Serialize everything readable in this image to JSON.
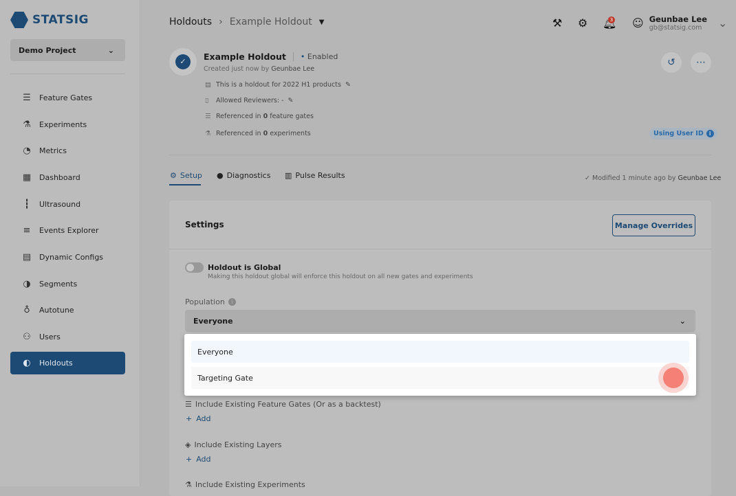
{
  "sidebar": {
    "brand": "STATSIG",
    "project": "Demo Project",
    "items": [
      {
        "label": "Feature Gates",
        "icon": "sliders-icon"
      },
      {
        "label": "Experiments",
        "icon": "flask-icon"
      },
      {
        "label": "Metrics",
        "icon": "gauge-icon"
      },
      {
        "label": "Dashboard",
        "icon": "dashboard-icon"
      },
      {
        "label": "Ultrasound",
        "icon": "waveform-icon"
      },
      {
        "label": "Events Explorer",
        "icon": "search-list-icon"
      },
      {
        "label": "Dynamic Configs",
        "icon": "config-icon"
      },
      {
        "label": "Segments",
        "icon": "pie-icon"
      },
      {
        "label": "Autotune",
        "icon": "autotune-icon"
      },
      {
        "label": "Users",
        "icon": "users-icon"
      },
      {
        "label": "Holdouts",
        "icon": "holdout-icon",
        "active": true
      }
    ]
  },
  "header": {
    "breadcrumb": [
      "Holdouts",
      "Example Holdout"
    ],
    "notifications": "3",
    "user_name": "Geunbae Lee",
    "user_email": "gb@statsig.com"
  },
  "holdout": {
    "name": "Example Holdout",
    "status": "Enabled",
    "created": "Created just now by",
    "creator": "Geunbae Lee",
    "description": "This is a holdout for 2022 H1 products",
    "reviewers": "Allowed Reviewers: -",
    "ref_gates_pre": "Referenced in ",
    "ref_gates_n": "0",
    "ref_gates_post": " feature gates",
    "ref_exp_pre": "Referenced in ",
    "ref_exp_n": "0",
    "ref_exp_post": " experiments",
    "id_type": "Using User ID"
  },
  "tabs": [
    {
      "label": "Setup",
      "active": true
    },
    {
      "label": "Diagnostics"
    },
    {
      "label": "Pulse Results"
    }
  ],
  "modified": {
    "text": "Modified 1 minute ago by",
    "by": "Geunbae Lee"
  },
  "settings": {
    "title": "Settings",
    "manage_overrides": "Manage Overrides",
    "global_label": "Holdout is Global",
    "global_on": false,
    "global_desc": "Making this holdout global will enforce this holdout on all new gates and experiments",
    "population_label": "Population",
    "population_value": "Everyone",
    "options": [
      "Everyone",
      "Targeting Gate"
    ],
    "sections": [
      "Include Existing Feature Gates (Or as a backtest)",
      "Include Existing Layers",
      "Include Existing Experiments"
    ],
    "add_label": "Add"
  },
  "colors": {
    "brand": "#1d4a74",
    "click_marker": "#f48076"
  }
}
